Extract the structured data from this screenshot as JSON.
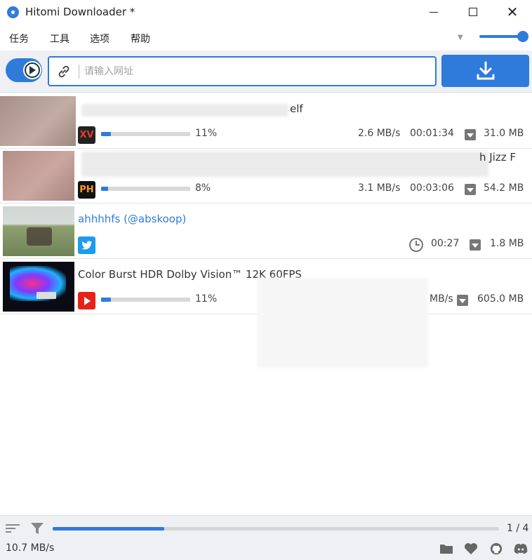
{
  "window": {
    "title": "Hitomi Downloader *"
  },
  "menu": [
    "任务",
    "工具",
    "选项",
    "帮助"
  ],
  "toolbar": {
    "url_placeholder": "请输入网址"
  },
  "downloads": [
    {
      "title": "elf",
      "site": "XV",
      "site_color": "#c0392b",
      "progress": 0.11,
      "percent": "11%",
      "speed": "2.6 MB/s",
      "eta": "00:01:34",
      "size": "31.0 MB"
    },
    {
      "title": "h Jizz F",
      "site": "PH",
      "site_color": "#111111",
      "progress": 0.08,
      "percent": "8%",
      "speed": "3.1 MB/s",
      "eta": "00:03:06",
      "size": "54.2 MB"
    },
    {
      "title": "ahhhhfs (@abskoop)",
      "site": "twitter",
      "site_color": "#1d9bf0",
      "duration": "00:27",
      "size": "1.8 MB"
    },
    {
      "title": "Color Burst HDR Dolby Vision™ 12K 60FPS",
      "site": "youtube",
      "site_color": "#e62117",
      "progress": 0.11,
      "percent": "11%",
      "speed": "MB/s",
      "size": "605.0 MB"
    }
  ],
  "status": {
    "total_progress": 0.25,
    "count": "1 / 4",
    "total_speed": "10.7 MB/s"
  },
  "colors": {
    "accent": "#2f7bdc",
    "toolbar_bg": "#eef0f3"
  }
}
